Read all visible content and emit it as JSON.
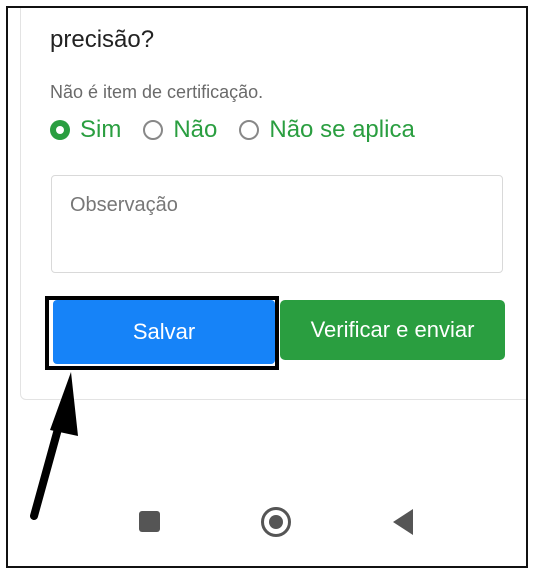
{
  "form": {
    "question_text": "precisão?",
    "hint": "Não é item de certificação.",
    "options": [
      {
        "label": "Sim",
        "selected": true
      },
      {
        "label": "Não",
        "selected": false
      },
      {
        "label": "Não se aplica",
        "selected": false
      }
    ],
    "observation": {
      "placeholder": "Observação",
      "value": ""
    }
  },
  "buttons": {
    "save_label": "Salvar",
    "send_label": "Verificar e enviar"
  },
  "colors": {
    "accent_green": "#2a9e40",
    "save_blue": "#1683f8",
    "annotation": "#000000"
  },
  "navbar": {
    "icons": [
      "recents-square-icon",
      "home-circle-icon",
      "back-triangle-icon"
    ]
  }
}
